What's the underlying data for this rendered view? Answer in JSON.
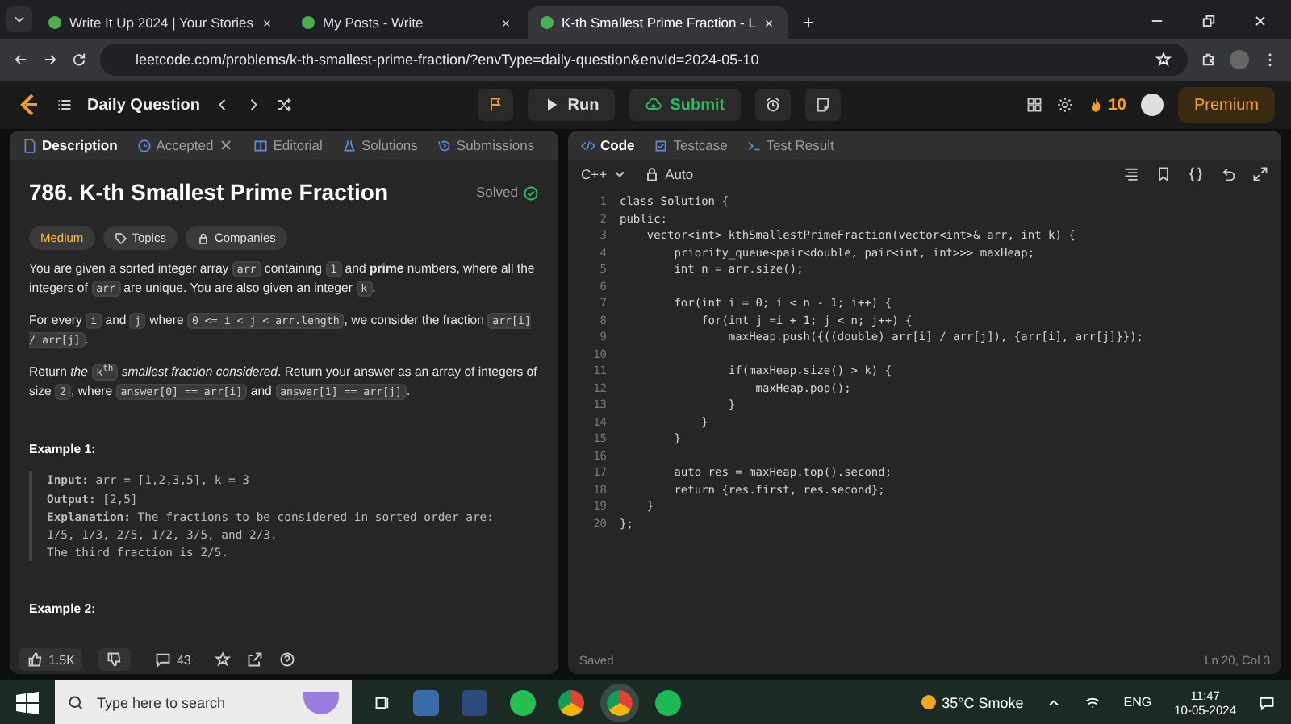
{
  "browser": {
    "tabs": [
      {
        "title": "Write It Up 2024 | Your Stories",
        "selected": false
      },
      {
        "title": "My Posts - Write",
        "selected": false
      },
      {
        "title": "K-th Smallest Prime Fraction - L",
        "selected": true
      }
    ],
    "url": "leetcode.com/problems/k-th-smallest-prime-fraction/?envType=daily-question&envId=2024-05-10"
  },
  "header": {
    "daily": "Daily Question",
    "run": "Run",
    "submit": "Submit",
    "streak": "10",
    "premium": "Premium"
  },
  "left": {
    "tabs": [
      {
        "label": "Description",
        "selected": true,
        "closable": false
      },
      {
        "label": "Accepted",
        "selected": false,
        "closable": true
      },
      {
        "label": "Editorial",
        "selected": false,
        "closable": false
      },
      {
        "label": "Solutions",
        "selected": false,
        "closable": false
      },
      {
        "label": "Submissions",
        "selected": false,
        "closable": false
      }
    ],
    "title": "786. K-th Smallest Prime Fraction",
    "status": "Solved",
    "difficulty": "Medium",
    "chips": [
      "Topics",
      "Companies"
    ],
    "paragraphs": [
      [
        {
          "kind": "text",
          "text": "You are given a sorted integer array "
        },
        {
          "kind": "code",
          "text": "arr"
        },
        {
          "kind": "text",
          "text": " containing "
        },
        {
          "kind": "code",
          "text": "1"
        },
        {
          "kind": "text",
          "text": " and **prime** numbers, where all the integers of "
        },
        {
          "kind": "code",
          "text": "arr"
        },
        {
          "kind": "text",
          "text": " are unique. You are also given an integer "
        },
        {
          "kind": "code",
          "text": "k"
        },
        {
          "kind": "text",
          "text": "."
        }
      ],
      [
        {
          "kind": "text",
          "text": "For every "
        },
        {
          "kind": "code",
          "text": "i"
        },
        {
          "kind": "text",
          "text": " and "
        },
        {
          "kind": "code",
          "text": "j"
        },
        {
          "kind": "text",
          "text": " where "
        },
        {
          "kind": "code",
          "text": "0 <= i < j < arr.length"
        },
        {
          "kind": "text",
          "text": ", we consider the fraction "
        },
        {
          "kind": "code",
          "text": "arr[i] / arr[j]"
        },
        {
          "kind": "text",
          "text": "."
        }
      ],
      [
        {
          "kind": "text",
          "text": "Return *the* "
        },
        {
          "kind": "code",
          "text": "k$^{th}$"
        },
        {
          "kind": "text",
          "text": " *smallest fraction considered*. Return your answer as an array of integers of size "
        },
        {
          "kind": "code",
          "text": "2"
        },
        {
          "kind": "text",
          "text": ", where "
        },
        {
          "kind": "code",
          "text": "answer[0] == arr[i]"
        },
        {
          "kind": "text",
          "text": " and "
        },
        {
          "kind": "code",
          "text": "answer[1] == arr[j]"
        },
        {
          "kind": "text",
          "text": "."
        }
      ]
    ],
    "examples": [
      {
        "title": "Example 1:",
        "lines": [
          "**Input:** arr = [1,2,3,5], k = 3",
          "**Output:** [2,5]",
          "**Explanation:** The fractions to be considered in sorted order are:",
          "1/5, 1/3, 2/5, 1/2, 3/5, and 2/3.",
          "The third fraction is 2/5."
        ]
      },
      {
        "title": "Example 2:"
      }
    ],
    "likes": "1.5K",
    "comments": "43"
  },
  "right": {
    "tabs": [
      {
        "label": "Code",
        "selected": true
      },
      {
        "label": "Testcase",
        "selected": false
      },
      {
        "label": "Test Result",
        "selected": false
      }
    ],
    "language": "C++",
    "mode": "Auto",
    "code": [
      {
        "number": "1",
        "text": "class Solution {"
      },
      {
        "number": "2",
        "text": "public:"
      },
      {
        "number": "3",
        "text": "    vector<int> kthSmallestPrimeFraction(vector<int>& arr, int k) {"
      },
      {
        "number": "4",
        "text": "        priority_queue<pair<double, pair<int, int>>> maxHeap;"
      },
      {
        "number": "5",
        "text": "        int n = arr.size();"
      },
      {
        "number": "6"
      },
      {
        "number": "7",
        "text": "        for(int i = 0; i < n - 1; i++) {"
      },
      {
        "number": "8",
        "text": "            for(int j =i + 1; j < n; j++) {"
      },
      {
        "number": "9",
        "text": "                maxHeap.push({((double) arr[i] / arr[j]), {arr[i], arr[j]}});"
      },
      {
        "number": "10"
      },
      {
        "number": "11",
        "text": "                if(maxHeap.size() > k) {"
      },
      {
        "number": "12",
        "text": "                    maxHeap.pop();"
      },
      {
        "number": "13",
        "text": "                }"
      },
      {
        "number": "14",
        "text": "            }"
      },
      {
        "number": "15",
        "text": "        }"
      },
      {
        "number": "16"
      },
      {
        "number": "17",
        "text": "        auto res = maxHeap.top().second;"
      },
      {
        "number": "18",
        "text": "        return {res.first, res.second};"
      },
      {
        "number": "19",
        "text": "    }"
      },
      {
        "number": "20",
        "text": "};"
      }
    ],
    "saved": "Saved",
    "position": "Ln 20, Col 3"
  },
  "taskbar": {
    "search_placeholder": "Type here to search",
    "weather": "35°C  Smoke",
    "lang": "ENG",
    "time": "11:47",
    "date": "10-05-2024"
  }
}
